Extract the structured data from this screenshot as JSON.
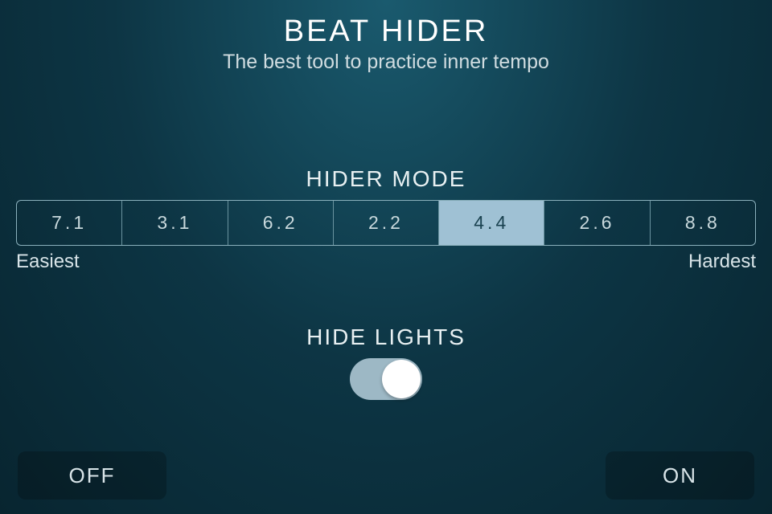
{
  "header": {
    "title": "BEAT HIDER",
    "subtitle": "The best tool to practice inner tempo"
  },
  "hiderMode": {
    "label": "HIDER MODE",
    "options": [
      "7.1",
      "3.1",
      "6.2",
      "2.2",
      "4.4",
      "2.6",
      "8.8"
    ],
    "selectedIndex": 4,
    "leftHint": "Easiest",
    "rightHint": "Hardest"
  },
  "hideLights": {
    "label": "HIDE LIGHTS",
    "value": true
  },
  "buttons": {
    "off": "OFF",
    "on": "ON"
  }
}
